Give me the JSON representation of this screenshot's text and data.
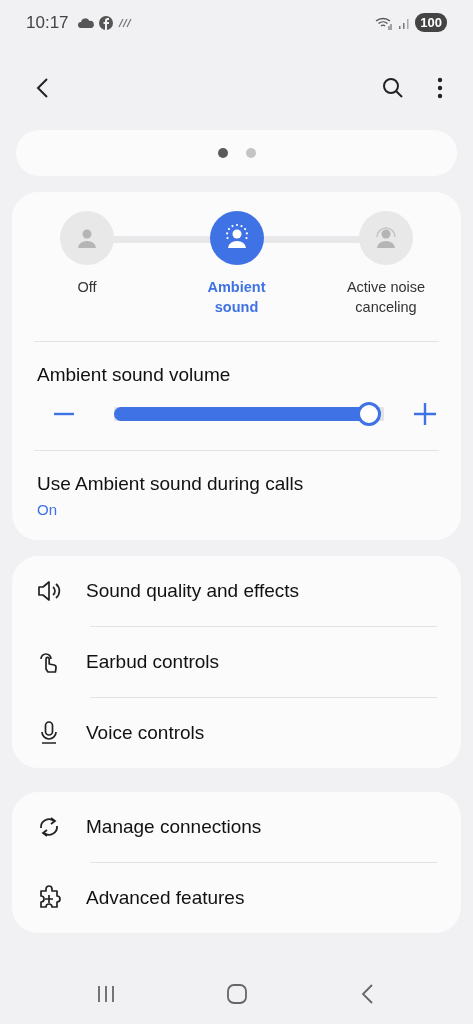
{
  "status_bar": {
    "time": "10:17",
    "battery": "100"
  },
  "pager": [
    {
      "selected": true
    },
    {
      "selected": false
    }
  ],
  "modes": [
    {
      "label": "Off",
      "selected": false,
      "kind": "off"
    },
    {
      "label": "Ambient sound",
      "selected": true,
      "kind": "ambient"
    },
    {
      "label": "Active noise canceling",
      "selected": false,
      "kind": "anc"
    }
  ],
  "volume": {
    "title": "Ambient sound volume",
    "level": 0.96
  },
  "call_setting": {
    "title": "Use Ambient sound during calls",
    "value": "On"
  },
  "menu_groups": [
    [
      {
        "label": "Sound quality and effects",
        "kind": "speaker"
      },
      {
        "label": "Earbud controls",
        "kind": "touch"
      },
      {
        "label": "Voice controls",
        "kind": "mic"
      }
    ],
    [
      {
        "label": "Manage connections",
        "kind": "sync"
      },
      {
        "label": "Advanced features",
        "kind": "puzzle"
      }
    ]
  ]
}
